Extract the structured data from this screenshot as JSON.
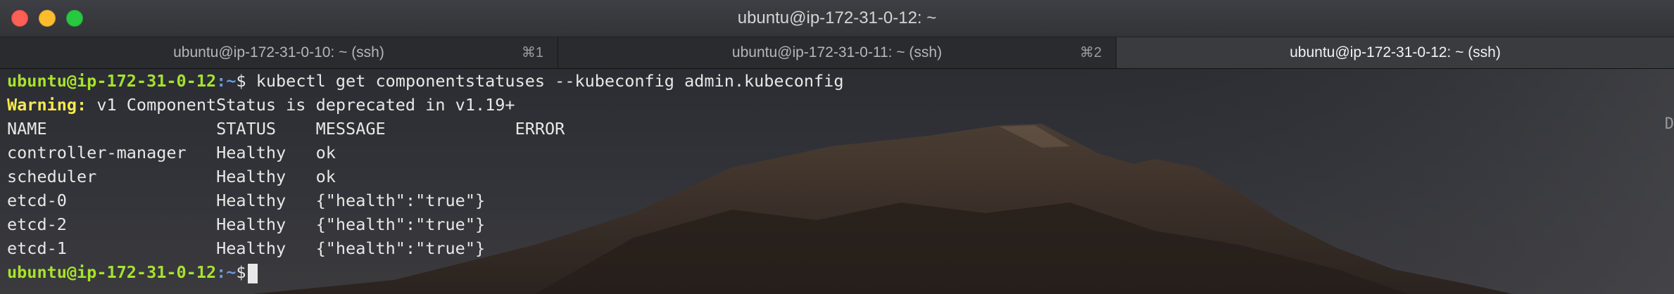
{
  "window": {
    "title": "ubuntu@ip-172-31-0-12: ~"
  },
  "tabs": [
    {
      "label": "ubuntu@ip-172-31-0-10: ~ (ssh)",
      "shortcut": "⌘1"
    },
    {
      "label": "ubuntu@ip-172-31-0-11: ~ (ssh)",
      "shortcut": "⌘2"
    },
    {
      "label": "ubuntu@ip-172-31-0-12: ~ (ssh)",
      "shortcut": ""
    }
  ],
  "colors": {
    "prompt": "#a7e22e",
    "path": "#6b9bd6",
    "warning": "#f5e94f",
    "text": "#e8e8e8"
  },
  "terminal": {
    "prompt_user_host": "ubuntu@ip-172-31-0-12",
    "prompt_path": ":~",
    "prompt_symbol": "$",
    "command": " kubectl get componentstatuses --kubeconfig admin.kubeconfig",
    "warning_label": "Warning:",
    "warning_text": " v1 ComponentStatus is deprecated in v1.19+",
    "headers": {
      "name": "NAME",
      "status": "STATUS",
      "message": "MESSAGE",
      "error": "ERROR"
    },
    "rows": [
      {
        "name": "controller-manager",
        "status": "Healthy",
        "message": "ok",
        "error": ""
      },
      {
        "name": "scheduler",
        "status": "Healthy",
        "message": "ok",
        "error": ""
      },
      {
        "name": "etcd-0",
        "status": "Healthy",
        "message": "{\"health\":\"true\"}",
        "error": ""
      },
      {
        "name": "etcd-2",
        "status": "Healthy",
        "message": "{\"health\":\"true\"}",
        "error": ""
      },
      {
        "name": "etcd-1",
        "status": "Healthy",
        "message": "{\"health\":\"true\"}",
        "error": ""
      }
    ],
    "edge_char": "D"
  }
}
